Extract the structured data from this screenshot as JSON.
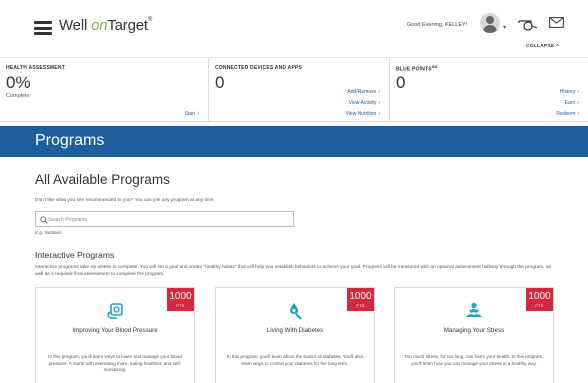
{
  "header": {
    "logo_text_1": "Well ",
    "logo_text_2": "on",
    "logo_text_3": "Target",
    "logo_reg": "®",
    "greeting": "Good Evening, KELLEY!",
    "collapse_label": "COLLAPSE ^"
  },
  "summary": {
    "health": {
      "title": "HEALTH ASSESSMENT",
      "value": "0%",
      "sub": "Complete",
      "start_label": "Start"
    },
    "devices": {
      "title": "CONNECTED DEVICES AND APPS",
      "value": "0",
      "links": [
        "Add/Remove",
        "View Activity",
        "View Nutrition"
      ]
    },
    "points": {
      "title": "BLUE POINTS",
      "title_sup": "SM",
      "value": "0",
      "links": [
        "History",
        "Earn",
        "Redeem"
      ]
    }
  },
  "banner": {
    "title": "Programs"
  },
  "main": {
    "title": "All Available Programs",
    "intro": "Don't like what you see recommended to you? You can join any program at any time.",
    "search_placeholder": "Search Programs",
    "search_hint": "E.g. Nutrition",
    "section_title": "Interactive Programs",
    "section_desc": "Interactive programs take six weeks to complete. You will set a goal and create \"healthy habits\" that will help you establish behaviors to achieve your goal. Progress will be measured with an optional assessment halfway through the program, as well as a required final assessment to complete the program."
  },
  "cards": [
    {
      "points": "1000",
      "pts_label": "PTS",
      "icon": "blood-pressure-icon",
      "title": "Improving Your Blood Pressure",
      "desc": "In this program, you'll learn ways to lower and manage your blood pressure. It starts with exercising more, eating healthier, and self-monitoring."
    },
    {
      "points": "1000",
      "pts_label": "PTS",
      "icon": "glucose-meter-icon",
      "title": "Living With Diabetes",
      "desc": "In this program, you'll learn about the basics of diabetes. You'll also learn ways to control your diabetes for the long term."
    },
    {
      "points": "1000",
      "pts_label": "PTS",
      "icon": "meditation-icon",
      "title": "Managing Your Stress",
      "desc": "Too much stress, for too long, can harm your health. In this program, you'll learn how you can manage your stress in a healthy way."
    }
  ],
  "colors": {
    "banner": "#1d5f9e",
    "badge": "#d4283e",
    "icon": "#1ca7c9",
    "link": "#1a5b9c",
    "logo_accent": "#7fb23a"
  }
}
